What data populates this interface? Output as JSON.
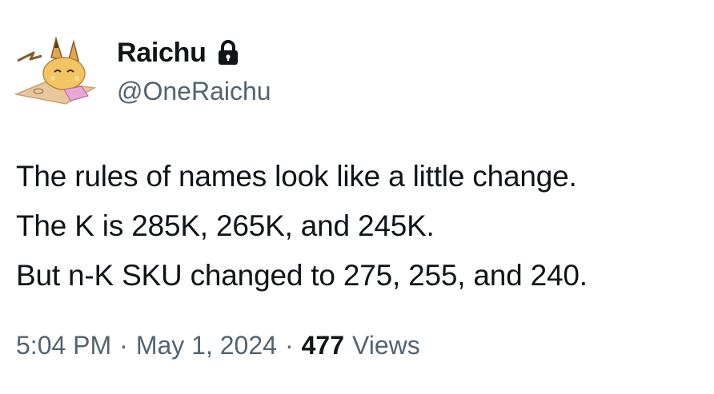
{
  "author": {
    "display_name": "Raichu",
    "handle": "@OneRaichu",
    "protected_icon": "lock-icon",
    "avatar_icon": "raichu-avatar"
  },
  "tweet": {
    "lines": [
      "The rules of names look like a little change.",
      "The K is 285K, 265K, and 245K.",
      "But n-K SKU changed to 275, 255, and 240."
    ]
  },
  "meta": {
    "time": "5:04 PM",
    "separator": "·",
    "date": "May 1, 2024",
    "views_count": "477",
    "views_label": "Views"
  },
  "colors": {
    "text_primary": "#0f1419",
    "text_secondary": "#536471",
    "background": "#ffffff"
  }
}
